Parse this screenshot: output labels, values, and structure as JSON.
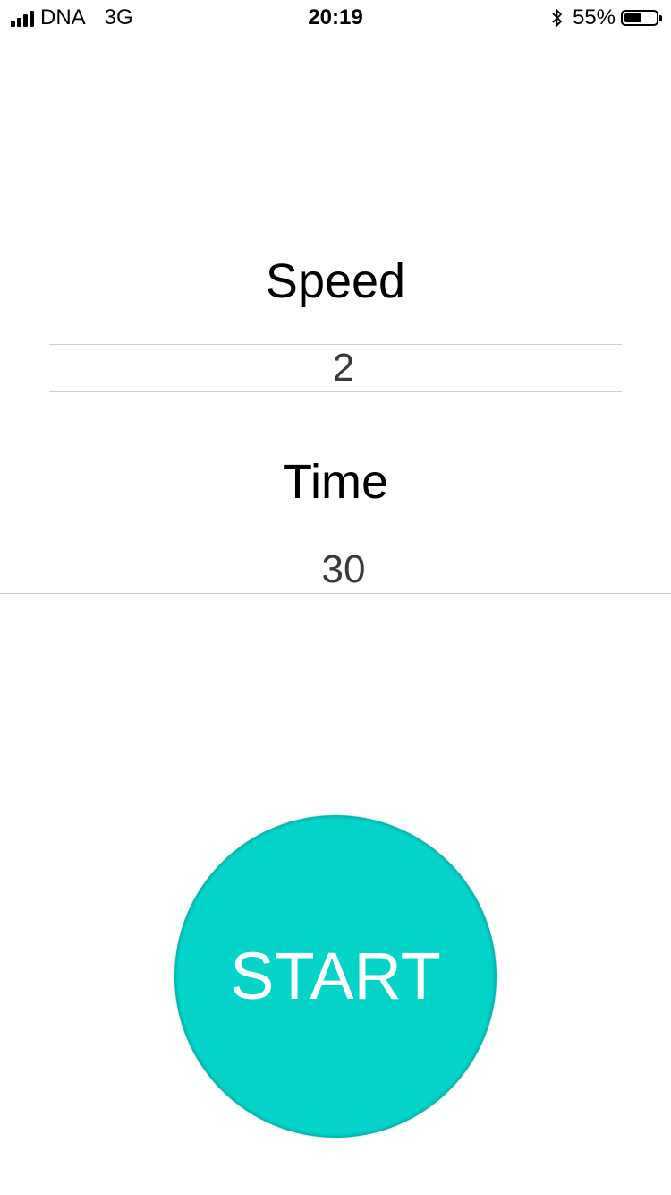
{
  "status_bar": {
    "carrier": "DNA",
    "network": "3G",
    "time": "20:19",
    "battery_percent": "55%",
    "battery_level": 0.55,
    "signal_icon": "signal-bars-icon",
    "bluetooth_icon": "bluetooth-icon",
    "battery_icon": "battery-icon"
  },
  "form": {
    "speed_label": "Speed",
    "speed_value": "2",
    "time_label": "Time",
    "time_value": "30"
  },
  "start_button": {
    "label": "START",
    "color": "#03d3c9"
  }
}
